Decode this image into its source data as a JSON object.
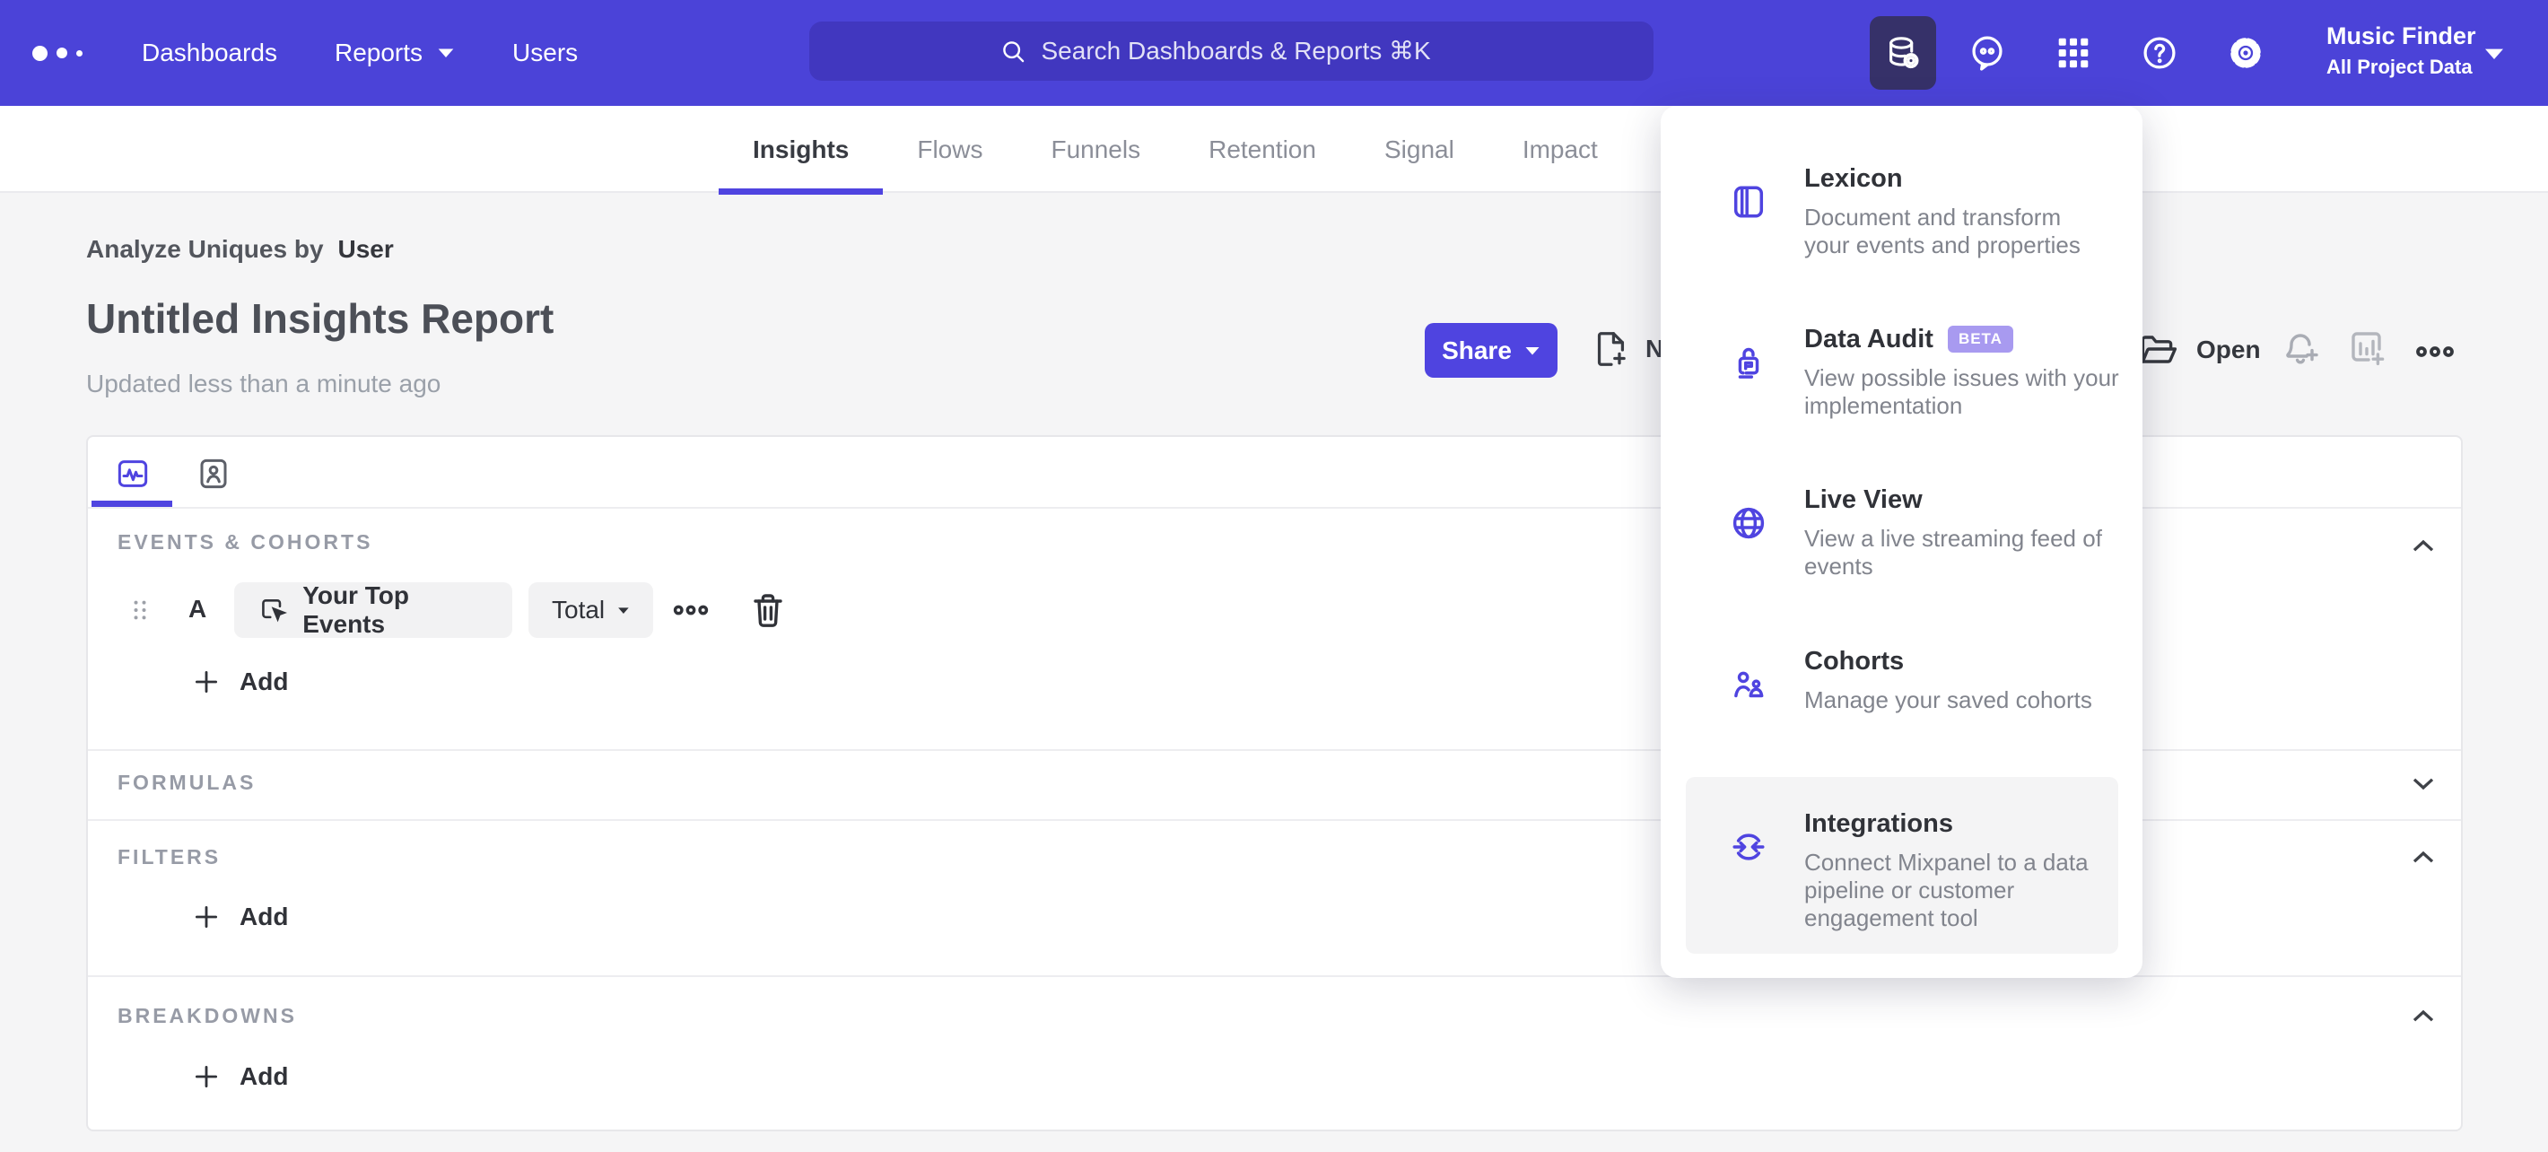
{
  "nav": {
    "items": [
      {
        "label": "Dashboards"
      },
      {
        "label": "Reports"
      },
      {
        "label": "Users"
      }
    ],
    "search_placeholder": "Search Dashboards & Reports ⌘K",
    "project": {
      "name": "Music Finder",
      "scope": "All Project Data"
    }
  },
  "tabs": [
    {
      "label": "Insights"
    },
    {
      "label": "Flows"
    },
    {
      "label": "Funnels"
    },
    {
      "label": "Retention"
    },
    {
      "label": "Signal"
    },
    {
      "label": "Impact"
    }
  ],
  "report": {
    "analyze_prefix": "Analyze Uniques by",
    "analyze_value": "User",
    "title": "Untitled Insights Report",
    "updated": "Updated less than a minute ago",
    "share_label": "Share",
    "new_label": "New",
    "open_label": "Open"
  },
  "builder": {
    "events": {
      "header": "EVENTS & COHORTS",
      "row_letter": "A",
      "event_name": "Your Top Events",
      "metric": "Total",
      "add_label": "Add"
    },
    "formulas": {
      "header": "FORMULAS"
    },
    "filters": {
      "header": "FILTERS",
      "add_label": "Add"
    },
    "breakdowns": {
      "header": "BREAKDOWNS",
      "add_label": "Add"
    }
  },
  "menu": {
    "items": [
      {
        "title": "Lexicon",
        "desc": "Document and transform\nyour events and properties"
      },
      {
        "title": "Data Audit",
        "badge": "BETA",
        "desc": "View possible issues with your\nimplementation"
      },
      {
        "title": "Live View",
        "desc": "View a live streaming feed of\nevents"
      },
      {
        "title": "Cohorts",
        "desc": "Manage your saved cohorts"
      },
      {
        "title": "Integrations",
        "desc": "Connect Mixpanel to a data\npipeline or customer\nengagement tool"
      }
    ]
  },
  "colors": {
    "accent": "#4f44e0",
    "nav_bg": "#4b43d8",
    "nav_search_bg": "#4137bf",
    "nav_active_bg": "#363169",
    "beta_bg": "#a89af0",
    "page_bg": "#f5f5f6"
  }
}
